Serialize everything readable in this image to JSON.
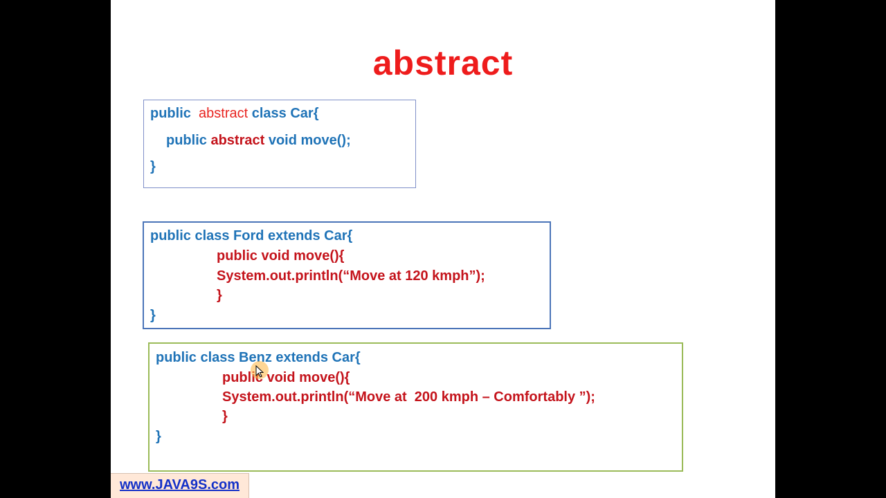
{
  "slide": {
    "title": "abstract"
  },
  "code": {
    "car": {
      "line1_kw": "public",
      "line1_abs": "abstract",
      "line1_rest": "class Car{",
      "line2_kw": "public",
      "line2_abs": "abstract",
      "line2_rest": "void move();",
      "line3": "}"
    },
    "ford": {
      "line1": "public class Ford extends Car{",
      "line2": "public void move(){",
      "line3": "System.out.println(“Move at 120 kmph”);",
      "line4": "}",
      "line5": "}"
    },
    "benz": {
      "line1": "public class Benz extends Car{",
      "line2": "public void move(){",
      "line3": "System.out.println(“Move at  200 kmph – Comfortably ”);",
      "line4": "}",
      "line5": "}"
    }
  },
  "footer": {
    "link_text": "www.JAVA9S.com"
  },
  "colors": {
    "title": "#ee1c1c",
    "code_blue": "#1f73b7",
    "code_red": "#c4131b",
    "link": "#1330c8"
  }
}
